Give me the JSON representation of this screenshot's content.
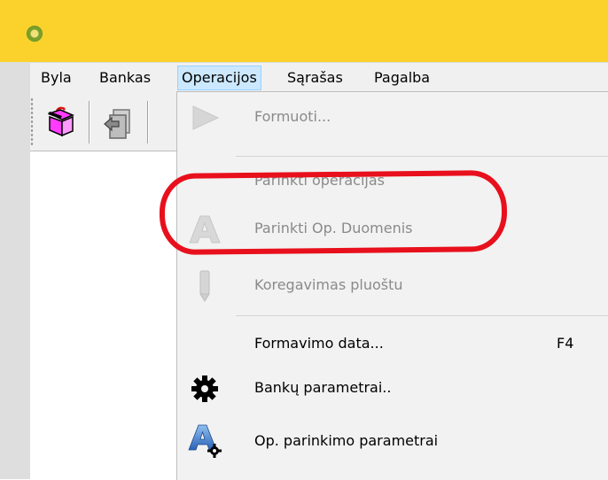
{
  "window": {
    "app_icon": "app-logo-icon"
  },
  "menubar": {
    "items": [
      {
        "label": "Byla"
      },
      {
        "label": "Bankas"
      },
      {
        "label": "Operacijos"
      },
      {
        "label": "Sąrašas"
      },
      {
        "label": "Pagalba"
      }
    ],
    "active": "Operacijos"
  },
  "toolbar": {
    "buttons": [
      {
        "icon": "open-box-icon"
      },
      {
        "icon": "document-back-icon"
      }
    ]
  },
  "operacijos_menu": {
    "items": [
      {
        "label": "Formuoti...",
        "icon": "play-icon",
        "enabled": false
      },
      {
        "label": "Parinkti operacijas",
        "enabled": false
      },
      {
        "label": "Parinkti Op. Duomenis",
        "icon": "letter-a-icon",
        "enabled": false
      },
      {
        "label": "Koregavimas pluoštu",
        "icon": "pencil-icon",
        "enabled": false
      },
      {
        "label": "Formavimo data...",
        "shortcut": "F4",
        "enabled": true
      },
      {
        "label": "Bankų parametrai..",
        "icon": "gear-icon",
        "enabled": true
      },
      {
        "label": "Op. parinkimo parametrai",
        "icon": "letter-a-gear-icon",
        "enabled": true
      }
    ]
  },
  "annotation": {
    "color": "#e8101c"
  },
  "colors": {
    "titlebar": "#fbd22b",
    "menu_highlight": "#cce8ff",
    "menu_background": "#f2f2f2"
  }
}
